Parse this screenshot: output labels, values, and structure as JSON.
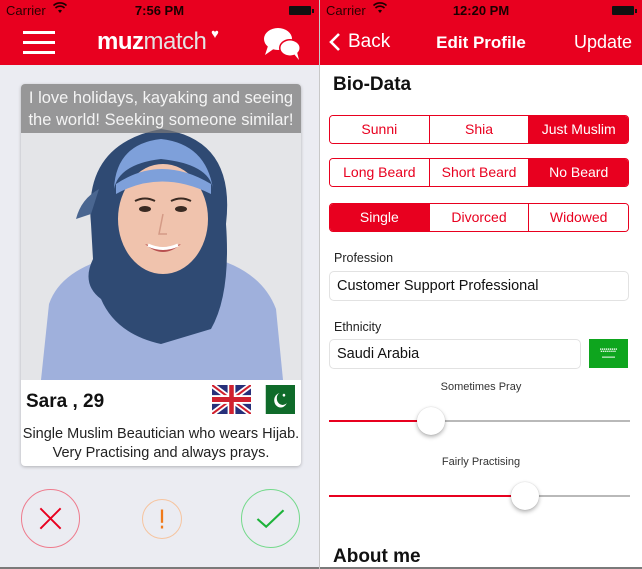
{
  "left_screen": {
    "status_bar": {
      "carrier": "Carrier",
      "time": "7:56 PM"
    },
    "nav": {
      "logo_part1": "muz",
      "logo_part2": "match",
      "logo_heart": "♥",
      "menu_icon": "hamburger-menu-icon",
      "chat_icon": "chat-bubbles-icon"
    },
    "profile_card": {
      "tagline": "I love holidays, kayaking and seeing the world! Seeking someone similar!",
      "name_age": "Sara , 29",
      "flags": [
        "United Kingdom",
        "Pakistan"
      ],
      "bio": "Single Muslim Beautician who wears Hijab. Very Practising and always prays."
    },
    "actions": {
      "reject_icon": "x-icon",
      "report_icon": "exclamation-icon",
      "report_label": "!",
      "accept_icon": "checkmark-icon"
    },
    "colors": {
      "brand": "#e8001f",
      "reject": "#e8001f",
      "report": "#f07a1a",
      "accept": "#1db33a"
    }
  },
  "right_screen": {
    "status_bar": {
      "carrier": "Carrier",
      "time": "12:20 PM"
    },
    "nav": {
      "back_label": "Back",
      "title": "Edit Profile",
      "update_label": "Update"
    },
    "bio_data_title": "Bio-Data",
    "sect": {
      "options": [
        "Sunni",
        "Shia",
        "Just Muslim"
      ],
      "selected": "Just Muslim"
    },
    "beard": {
      "options": [
        "Long Beard",
        "Short Beard",
        "No Beard"
      ],
      "selected": "No Beard"
    },
    "marital_status": {
      "options": [
        "Single",
        "Divorced",
        "Widowed"
      ],
      "selected": "Single"
    },
    "profession": {
      "label": "Profession",
      "value": "Customer Support Professional"
    },
    "ethnicity": {
      "label": "Ethnicity",
      "value": "Saudi Arabia",
      "flag": "Saudi Arabia"
    },
    "prayer_slider": {
      "label": "Sometimes Pray",
      "value_fraction": 0.34
    },
    "religiosity_slider": {
      "label": "Fairly Practising",
      "value_fraction": 0.65
    },
    "about_title": "About me"
  }
}
